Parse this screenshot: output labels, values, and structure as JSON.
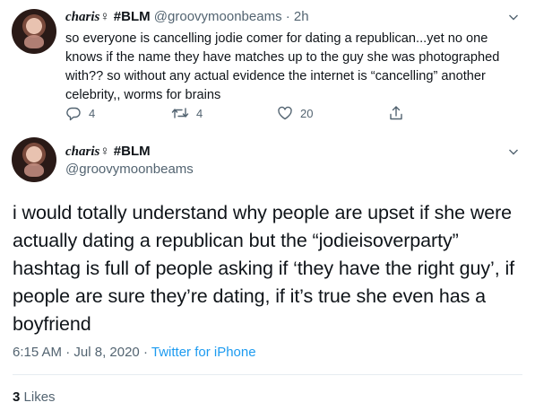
{
  "tweet1": {
    "name": "charis",
    "name_emoji": "♀",
    "tag": "#BLM",
    "handle": "@groovymoonbeams",
    "sep": "·",
    "time": "2h",
    "text": "so everyone is cancelling jodie comer for dating a republican...yet no one knows if the name they have matches up to the guy she was photographed with?? so without any actual evidence the internet is “cancelling” another celebrity,, worms for brains",
    "replies": "4",
    "retweets": "4",
    "likes": "20",
    "icons": [
      "reply-icon",
      "retweet-icon",
      "like-icon",
      "share-icon"
    ]
  },
  "tweet2": {
    "name": "charis",
    "name_emoji": "♀",
    "tag": "#BLM",
    "handle": "@groovymoonbeams",
    "text": "i would totally understand why people are upset if she were actually dating a republican but the “jodieisoverparty” hashtag is full of people asking if ‘they have the right guy’, if people are sure they’re dating, if it’s true she even has a boyfriend",
    "time": "6:15 AM",
    "sep": "·",
    "date": "Jul 8, 2020",
    "source": "Twitter for iPhone",
    "likes_count": "3",
    "likes_label": "Likes"
  },
  "colors": {
    "accent": "#1d9bf0",
    "secondary": "#536471",
    "text": "#0f1419"
  }
}
